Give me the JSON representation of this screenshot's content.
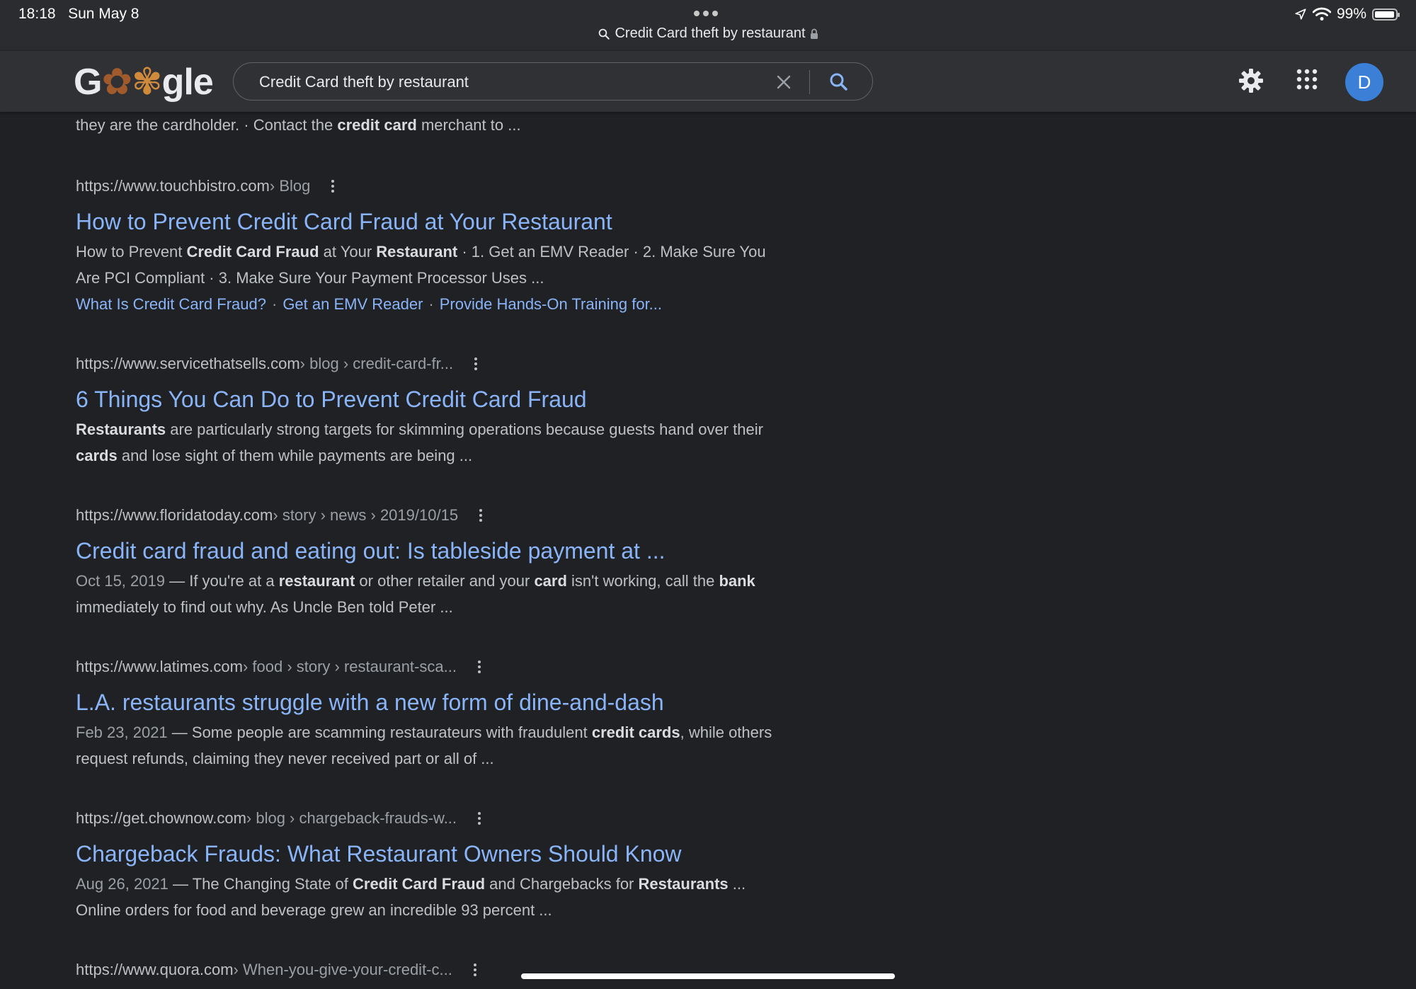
{
  "status_bar": {
    "time": "18:18",
    "date": "Sun May 8",
    "page_title": "Credit Card theft by restaurant",
    "battery": "99%"
  },
  "header": {
    "logo_text": {
      "g": "G",
      "doodle1": "✿",
      "doodle2": "✾",
      "rest": "gle"
    },
    "search_value": "Credit Card theft by restaurant",
    "avatar_letter": "D"
  },
  "results": {
    "partial_snippet": {
      "pre": "they are the cardholder. · Contact the ",
      "bold": "credit card",
      "post": " merchant to ..."
    },
    "items": [
      {
        "domain": "https://www.touchbistro.com",
        "crumbs": " › Blog",
        "title": "How to Prevent Credit Card Fraud at Your Restaurant",
        "snippet_parts": [
          {
            "t": "How to Prevent "
          },
          {
            "t": "Credit Card Fraud",
            "b": true
          },
          {
            "t": " at Your "
          },
          {
            "t": "Restaurant",
            "b": true
          },
          {
            "t": " · 1. Get an EMV Reader · 2. Make Sure You Are PCI Compliant · 3. Make Sure Your Payment Processor Uses ..."
          }
        ],
        "sitelinks": [
          "What Is Credit Card Fraud?",
          "Get an EMV Reader",
          "Provide Hands-On Training for..."
        ]
      },
      {
        "domain": "https://www.servicethatsells.com",
        "crumbs": " › blog › credit-card-fr...",
        "title": "6 Things You Can Do to Prevent Credit Card Fraud",
        "snippet_parts": [
          {
            "t": "Restaurants",
            "b": true
          },
          {
            "t": " are particularly strong targets for skimming operations because guests hand over their "
          },
          {
            "t": "cards",
            "b": true
          },
          {
            "t": " and lose sight of them while payments are being ..."
          }
        ]
      },
      {
        "domain": "https://www.floridatoday.com",
        "crumbs": " › story › news › 2019/10/15",
        "title": "Credit card fraud and eating out: Is tableside payment at ...",
        "snippet_parts": [
          {
            "t": "Oct 15, 2019",
            "d": true
          },
          {
            "t": " — If you're at a "
          },
          {
            "t": "restaurant",
            "b": true
          },
          {
            "t": " or other retailer and your "
          },
          {
            "t": "card",
            "b": true
          },
          {
            "t": " isn't working, call the "
          },
          {
            "t": "bank",
            "b": true
          },
          {
            "t": " immediately to find out why. As Uncle Ben told Peter ..."
          }
        ]
      },
      {
        "domain": "https://www.latimes.com",
        "crumbs": " › food › story › restaurant-sca...",
        "title": "L.A. restaurants struggle with a new form of dine-and-dash",
        "snippet_parts": [
          {
            "t": "Feb 23, 2021",
            "d": true
          },
          {
            "t": " — Some people are scamming restaurateurs with fraudulent "
          },
          {
            "t": "credit cards",
            "b": true
          },
          {
            "t": ", while others request refunds, claiming they never received part or all of ..."
          }
        ]
      },
      {
        "domain": "https://get.chownow.com",
        "crumbs": " › blog › chargeback-frauds-w...",
        "title": "Chargeback Frauds: What Restaurant Owners Should Know",
        "snippet_parts": [
          {
            "t": "Aug 26, 2021",
            "d": true
          },
          {
            "t": " — The Changing State of "
          },
          {
            "t": "Credit Card Fraud",
            "b": true
          },
          {
            "t": " and Chargebacks for "
          },
          {
            "t": "Restaurants",
            "b": true
          },
          {
            "t": " ... Online orders for food and beverage grew an incredible 93 percent ..."
          }
        ]
      },
      {
        "domain": "https://www.quora.com",
        "crumbs": " › When-you-give-your-credit-c...",
        "title": "",
        "snippet_parts": []
      }
    ]
  },
  "colors": {
    "background": "#202124",
    "header": "#303134",
    "link": "#8ab4f8",
    "text": "#bdc1c6",
    "avatar": "#3b7fd6"
  }
}
